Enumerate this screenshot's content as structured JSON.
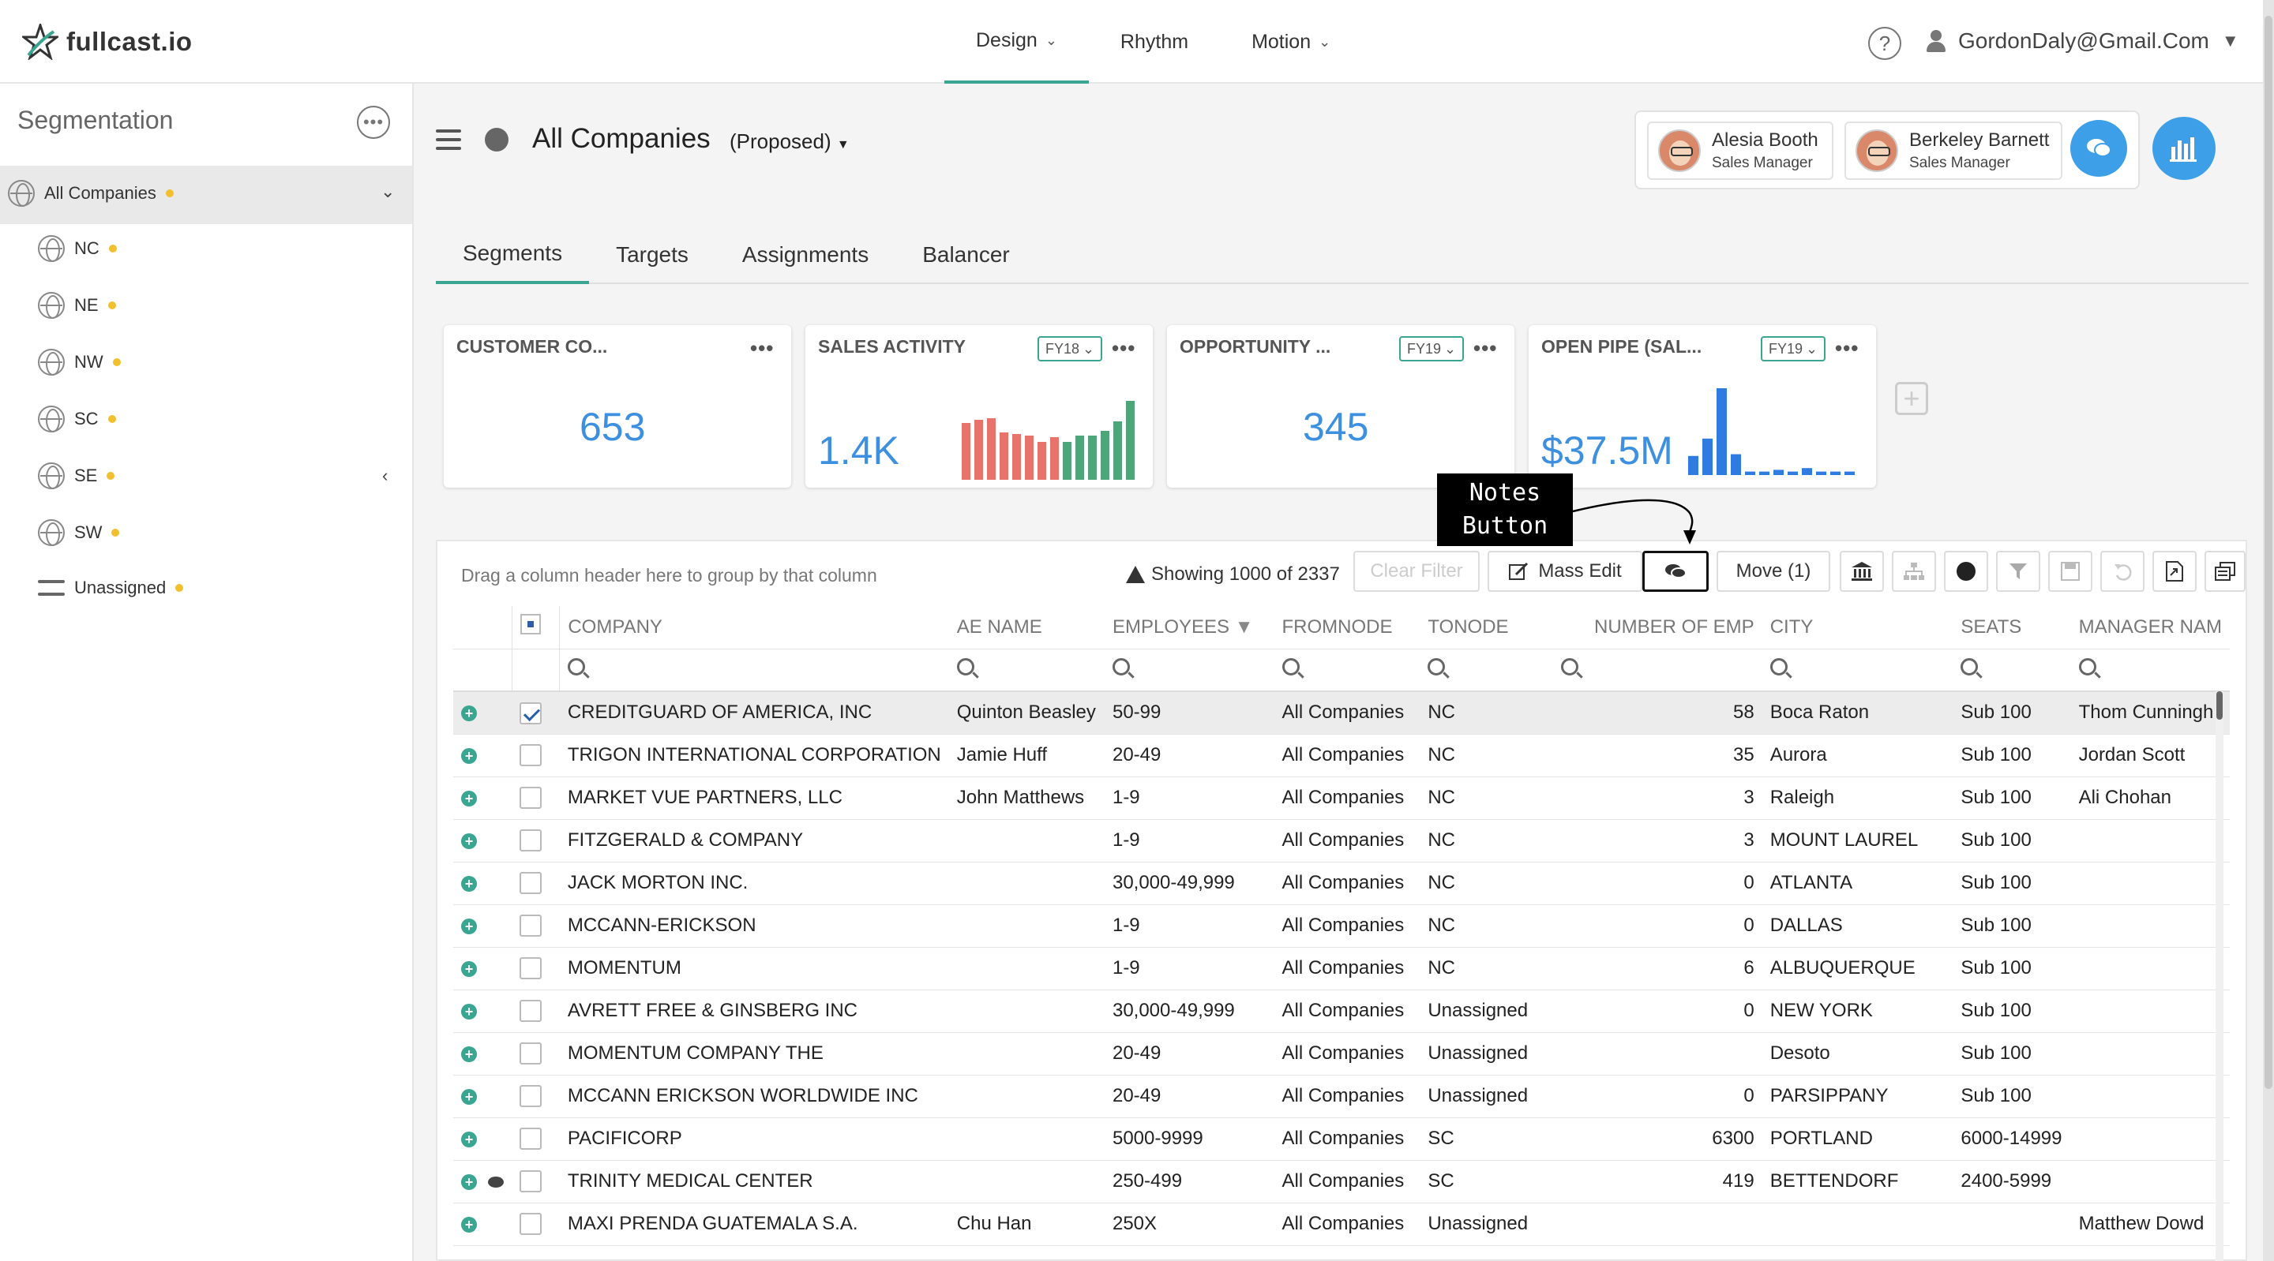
{
  "brand": {
    "name": "fullcast.io"
  },
  "topnav": {
    "items": [
      {
        "label": "Design",
        "has_caret": true,
        "active": true
      },
      {
        "label": "Rhythm",
        "has_caret": false,
        "active": false
      },
      {
        "label": "Motion",
        "has_caret": true,
        "active": false
      }
    ]
  },
  "help_label": "?",
  "user": {
    "email": "GordonDaly@Gmail.Com"
  },
  "sidebar": {
    "title": "Segmentation",
    "more": "•••",
    "root": {
      "label": "All Companies"
    },
    "items": [
      {
        "label": "NC"
      },
      {
        "label": "NE"
      },
      {
        "label": "NW"
      },
      {
        "label": "SC"
      },
      {
        "label": "SE"
      },
      {
        "label": "SW"
      }
    ],
    "unassigned": "Unassigned"
  },
  "header": {
    "title": "All Companies",
    "status": "(Proposed)"
  },
  "managers": [
    {
      "name": "Alesia Booth",
      "role": "Sales Manager"
    },
    {
      "name": "Berkeley Barnett",
      "role": "Sales Manager"
    }
  ],
  "tabs": [
    "Segments",
    "Targets",
    "Assignments",
    "Balancer"
  ],
  "kpis": [
    {
      "title": "CUSTOMER CO...",
      "value": "653",
      "fy": ""
    },
    {
      "title": "SALES ACTIVITY",
      "value": "1.4K",
      "fy": "FY18"
    },
    {
      "title": "OPPORTUNITY ...",
      "value": "345",
      "fy": "FY19"
    },
    {
      "title": "OPEN PIPE (SAL...",
      "value": "$37.5M",
      "fy": "FY19"
    }
  ],
  "kpi_more": "•••",
  "sales_activity_bars": {
    "red": [
      0.72,
      0.76,
      0.78,
      0.6,
      0.58,
      0.56,
      0.48,
      0.54
    ],
    "green": [
      0.48,
      0.56,
      0.56,
      0.62,
      0.74,
      1.0
    ]
  },
  "open_pipe_bars": [
    0.22,
    0.42,
    1.0,
    0.24,
    0.04,
    0.04,
    0.06,
    0.04,
    0.08,
    0.04,
    0.04,
    0.04
  ],
  "colors": {
    "accent": "#3aa590",
    "blue": "#3d8fe0",
    "red_bar": "#e8736c",
    "green_bar": "#4fa57a",
    "pipe_bar": "#2f7be0"
  },
  "grid": {
    "drag_hint": "Drag a column header here to group by that column",
    "showing": "Showing 1000 of 2337",
    "clear_filter": "Clear Filter",
    "mass_edit": "Mass Edit",
    "move": "Move (1)",
    "columns": [
      "COMPANY",
      "AE NAME",
      "EMPLOYEES",
      "FROMNODE",
      "TONODE",
      "NUMBER OF EMP",
      "CITY",
      "SEATS",
      "MANAGER NAM"
    ],
    "rows": [
      {
        "checked": true,
        "note": false,
        "company": "CREDITGUARD OF AMERICA, INC",
        "ae": "Quinton Beasley",
        "emp": "50-99",
        "from": "All Companies",
        "to": "NC",
        "num": "58",
        "city": "Boca Raton",
        "seats": "Sub 100",
        "mgr": "Thom Cunningh"
      },
      {
        "checked": false,
        "note": false,
        "company": "TRIGON INTERNATIONAL CORPORATION",
        "ae": "Jamie Huff",
        "emp": "20-49",
        "from": "All Companies",
        "to": "NC",
        "num": "35",
        "city": "Aurora",
        "seats": "Sub 100",
        "mgr": "Jordan Scott"
      },
      {
        "checked": false,
        "note": false,
        "company": "MARKET VUE PARTNERS, LLC",
        "ae": "John Matthews",
        "emp": "1-9",
        "from": "All Companies",
        "to": "NC",
        "num": "3",
        "city": "Raleigh",
        "seats": "Sub 100",
        "mgr": "Ali Chohan"
      },
      {
        "checked": false,
        "note": false,
        "company": "FITZGERALD & COMPANY",
        "ae": "",
        "emp": "1-9",
        "from": "All Companies",
        "to": "NC",
        "num": "3",
        "city": "MOUNT LAUREL",
        "seats": "Sub 100",
        "mgr": ""
      },
      {
        "checked": false,
        "note": false,
        "company": "JACK MORTON INC.",
        "ae": "",
        "emp": "30,000-49,999",
        "from": "All Companies",
        "to": "NC",
        "num": "0",
        "city": "ATLANTA",
        "seats": "Sub 100",
        "mgr": ""
      },
      {
        "checked": false,
        "note": false,
        "company": "MCCANN-ERICKSON",
        "ae": "",
        "emp": "1-9",
        "from": "All Companies",
        "to": "NC",
        "num": "0",
        "city": "DALLAS",
        "seats": "Sub 100",
        "mgr": ""
      },
      {
        "checked": false,
        "note": false,
        "company": "MOMENTUM",
        "ae": "",
        "emp": "1-9",
        "from": "All Companies",
        "to": "NC",
        "num": "6",
        "city": "ALBUQUERQUE",
        "seats": "Sub 100",
        "mgr": ""
      },
      {
        "checked": false,
        "note": false,
        "company": "AVRETT FREE & GINSBERG INC",
        "ae": "",
        "emp": "30,000-49,999",
        "from": "All Companies",
        "to": "Unassigned",
        "num": "0",
        "city": "NEW YORK",
        "seats": "Sub 100",
        "mgr": ""
      },
      {
        "checked": false,
        "note": false,
        "company": "MOMENTUM COMPANY THE",
        "ae": "",
        "emp": "20-49",
        "from": "All Companies",
        "to": "Unassigned",
        "num": "",
        "city": "Desoto",
        "seats": "Sub 100",
        "mgr": ""
      },
      {
        "checked": false,
        "note": false,
        "company": "MCCANN ERICKSON WORLDWIDE INC",
        "ae": "",
        "emp": "20-49",
        "from": "All Companies",
        "to": "Unassigned",
        "num": "0",
        "city": "PARSIPPANY",
        "seats": "Sub 100",
        "mgr": ""
      },
      {
        "checked": false,
        "note": false,
        "company": "PACIFICORP",
        "ae": "",
        "emp": "5000-9999",
        "from": "All Companies",
        "to": "SC",
        "num": "6300",
        "city": "PORTLAND",
        "seats": "6000-14999",
        "mgr": ""
      },
      {
        "checked": false,
        "note": true,
        "company": "TRINITY MEDICAL CENTER",
        "ae": "",
        "emp": "250-499",
        "from": "All Companies",
        "to": "SC",
        "num": "419",
        "city": "BETTENDORF",
        "seats": "2400-5999",
        "mgr": ""
      },
      {
        "checked": false,
        "note": false,
        "company": "MAXI PRENDA GUATEMALA S.A.",
        "ae": "Chu Han",
        "emp": "250X",
        "from": "All Companies",
        "to": "Unassigned",
        "num": "",
        "city": "",
        "seats": "",
        "mgr": "Matthew Dowd"
      }
    ]
  },
  "annotation": {
    "line1": "Notes",
    "line2": "Button"
  }
}
